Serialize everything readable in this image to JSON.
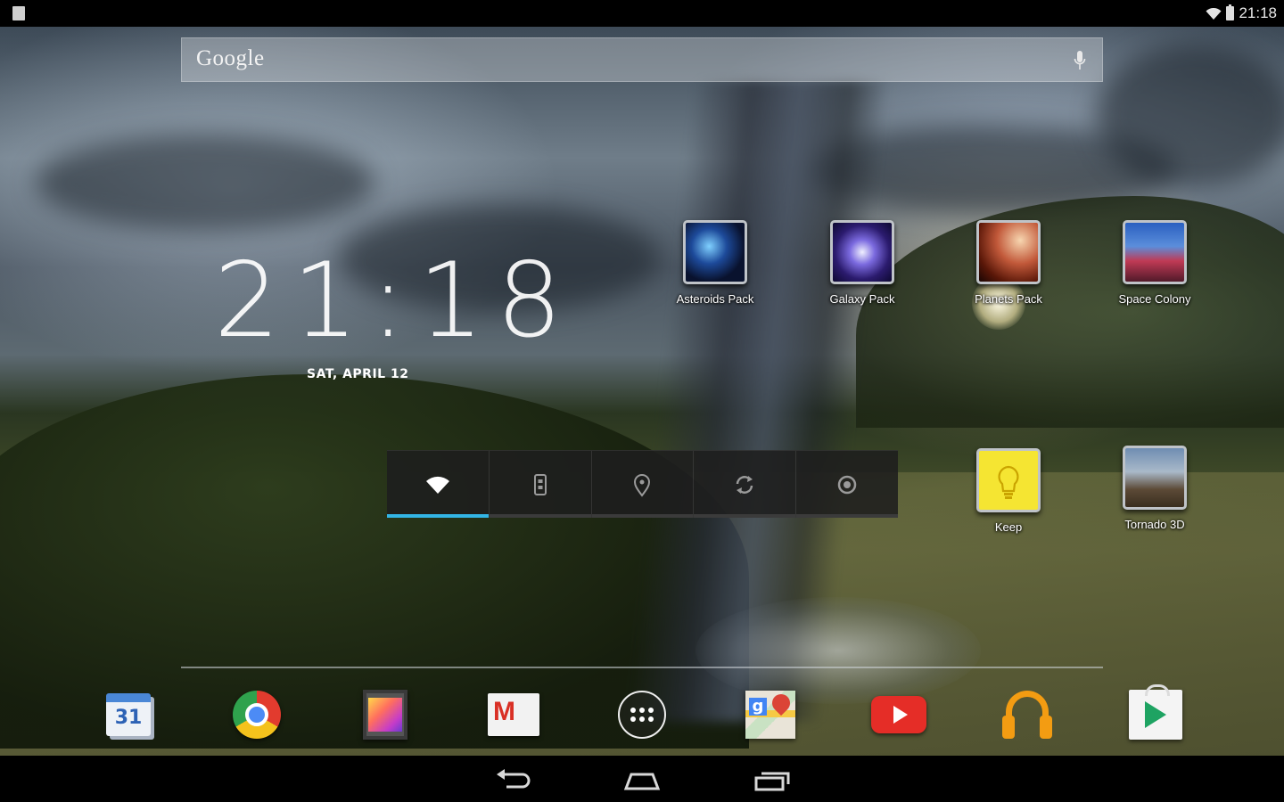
{
  "status_bar": {
    "time": "21:18",
    "icons": [
      "notification-icon",
      "wifi-icon",
      "battery-icon"
    ]
  },
  "search": {
    "logo_text": "Google",
    "mic_icon": "mic-icon"
  },
  "clock_widget": {
    "time": "21:18",
    "date": "SAT, APRIL 12"
  },
  "home_apps": [
    {
      "label": "Asteroids Pack",
      "icon": "asteroids-icon"
    },
    {
      "label": "Galaxy Pack",
      "icon": "galaxy-icon"
    },
    {
      "label": "Planets Pack",
      "icon": "planets-icon"
    },
    {
      "label": "Space Colony",
      "icon": "space-colony-icon"
    },
    {
      "label": "Keep",
      "icon": "keep-icon"
    },
    {
      "label": "Tornado 3D",
      "icon": "tornado-icon"
    }
  ],
  "power_widget": {
    "buttons": [
      {
        "name": "wifi-toggle",
        "icon": "wifi-icon",
        "on": true
      },
      {
        "name": "bluetooth-toggle",
        "icon": "bluetooth-icon",
        "on": false
      },
      {
        "name": "location-toggle",
        "icon": "location-pin-icon",
        "on": false
      },
      {
        "name": "sync-toggle",
        "icon": "sync-icon",
        "on": false
      },
      {
        "name": "brightness-toggle",
        "icon": "brightness-icon",
        "on": false
      }
    ],
    "accent_color": "#33b5e5"
  },
  "dock": {
    "apps": [
      {
        "name": "calendar",
        "icon": "calendar-icon",
        "text": "31"
      },
      {
        "name": "chrome",
        "icon": "chrome-icon"
      },
      {
        "name": "gallery",
        "icon": "gallery-icon"
      },
      {
        "name": "gmail",
        "icon": "gmail-icon",
        "text": "M"
      },
      {
        "name": "all-apps",
        "icon": "apps-grid-icon"
      },
      {
        "name": "maps",
        "icon": "maps-icon",
        "text": "g"
      },
      {
        "name": "youtube",
        "icon": "youtube-icon"
      },
      {
        "name": "play-music",
        "icon": "headphones-icon"
      },
      {
        "name": "play-store",
        "icon": "play-store-icon"
      }
    ]
  },
  "nav_bar": {
    "buttons": [
      "back-icon",
      "home-icon",
      "recents-icon"
    ]
  }
}
